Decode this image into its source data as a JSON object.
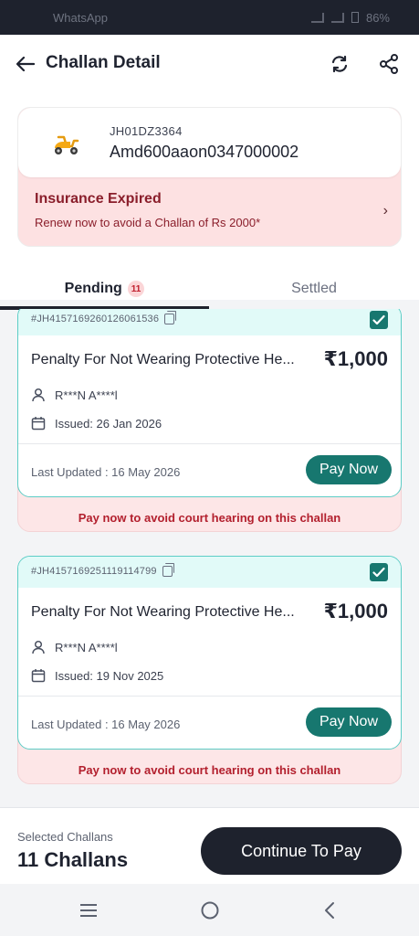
{
  "status_bar": {
    "app_name": "WhatsApp",
    "battery": "86%"
  },
  "header": {
    "title": "Challan Detail"
  },
  "icons": {
    "back": "arrow-left-icon",
    "refresh": "refresh-icon",
    "share": "share-icon",
    "vehicle": "scooter-icon",
    "owner": "user-icon",
    "issued": "calendar-icon",
    "copy": "copy-icon",
    "check": "checkbox-checked-icon"
  },
  "vehicle": {
    "registration": "JH01DZ3364",
    "chassis": "Amd600aaon0347000002"
  },
  "insurance": {
    "title": "Insurance Expired",
    "subtitle": "Renew now to avoid a Challan of Rs 2000*",
    "chevron": "›"
  },
  "tabs": {
    "pending_label": "Pending",
    "pending_count": "11",
    "settled_label": "Settled"
  },
  "challans": [
    {
      "id": "#JH4157169260126061536",
      "title": "Penalty For Not Wearing Protective He...",
      "amount": "₹1,000",
      "owner": "R***N A****l",
      "issued": "Issued: 26 Jan 2026",
      "last_updated": "Last Updated : 16 May 2026",
      "pay_label": "Pay Now",
      "warning": "Pay now to avoid court hearing on this challan",
      "selected": true
    },
    {
      "id": "#JH4157169251119114799",
      "title": "Penalty For Not Wearing Protective He...",
      "amount": "₹1,000",
      "owner": "R***N A****l",
      "issued": "Issued: 19 Nov 2025",
      "last_updated": "Last Updated : 16 May 2026",
      "pay_label": "Pay Now",
      "warning": "Pay now to avoid court hearing on this challan",
      "selected": true
    }
  ],
  "footer": {
    "selected_label": "Selected Challans",
    "selected_count": "11 Challans",
    "continue_label": "Continue To Pay"
  },
  "colors": {
    "accent_teal": "#17776f",
    "card_border": "#5ccdc6",
    "danger": "#b3202e",
    "dark": "#1e222d"
  }
}
